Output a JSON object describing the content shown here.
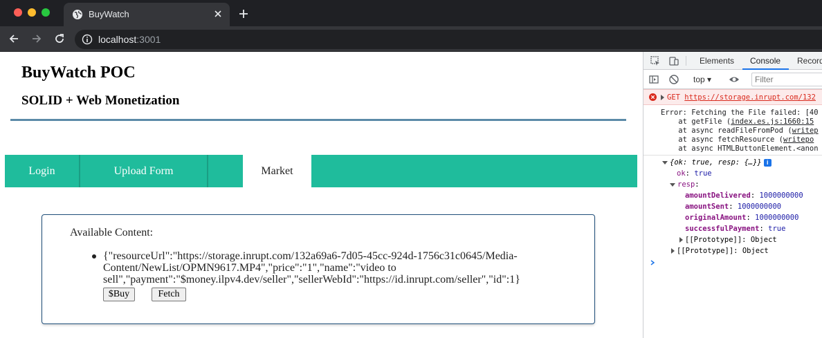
{
  "browser": {
    "tab_title": "BuyWatch",
    "url_host": "localhost",
    "url_port": ":3001"
  },
  "page": {
    "title": "BuyWatch POC",
    "subtitle": "SOLID + Web Monetization",
    "nav": {
      "login": "Login",
      "upload": "Upload Form",
      "market": "Market"
    },
    "content": {
      "heading": "Available Content:",
      "items": [
        {
          "text": "{\"resourceUrl\":\"https://storage.inrupt.com/132a69a6-7d05-45cc-924d-1756c31c0645/Media-Content/NewList/OPMN9617.MP4\",\"price\":\"1\",\"name\":\"video to sell\",\"payment\":\"$money.ilpv4.dev/seller\",\"sellerWebId\":\"https://id.inrupt.com/seller\",\"id\":1}",
          "buy_label": "$Buy",
          "fetch_label": "Fetch"
        }
      ]
    }
  },
  "devtools": {
    "tabs": {
      "elements": "Elements",
      "console": "Console",
      "recorder": "Record"
    },
    "context": "top",
    "filter_placeholder": "Filter",
    "error": {
      "method": "GET",
      "url": "https://storage.inrupt.com/132"
    },
    "trace": {
      "line1": "Error: Fetching the File failed: [40",
      "line2_prefix": "    at getFile (",
      "line2_link": "index.es.js:1660:15",
      "line3_prefix": "    at async readFileFromPod (",
      "line3_link": "writep",
      "line4_prefix": "    at async fetchResource (",
      "line4_link": "writepo",
      "line5": "    at async HTMLButtonElement.<anon"
    },
    "object": {
      "summary": "{ok: true, resp: {…}}",
      "ok_key": "ok",
      "ok_val": "true",
      "resp_key": "resp",
      "amountDelivered_key": "amountDelivered",
      "amountDelivered_val": "1000000000",
      "amountSent_key": "amountSent",
      "amountSent_val": "1000000000",
      "originalAmount_key": "originalAmount",
      "originalAmount_val": "1000000000",
      "successfulPayment_key": "successfulPayment",
      "successfulPayment_val": "true",
      "prototype_inner": "[[Prototype]]: Object",
      "prototype_outer": "[[Prototype]]: Object"
    }
  }
}
